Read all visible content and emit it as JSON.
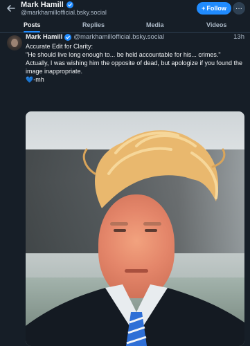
{
  "header": {
    "name": "Mark Hamill",
    "handle": "@markhamillofficial.bsky.social",
    "follow_label": "Follow",
    "more_label": "···"
  },
  "tabs": [
    {
      "label": "Posts",
      "active": true
    },
    {
      "label": "Replies",
      "active": false
    },
    {
      "label": "Media",
      "active": false
    },
    {
      "label": "Videos",
      "active": false
    }
  ],
  "post": {
    "author": "Mark Hamill",
    "handle": "@markhamillofficial.bsky.social",
    "time": "13h",
    "lines": [
      "Accurate Edit for Clarity:",
      "\"He should live long enough to...     be held accountable for his...      crimes.\"",
      "Actually, I was wishing him the opposite of dead, but apologize if you found the image inappropriate.",
      "💙-mh"
    ]
  },
  "colors": {
    "background": "#161e27",
    "accent": "#208bfe",
    "secondary_text": "#aebbc9"
  },
  "icons": [
    "back-arrow-icon",
    "verified-badge-icon",
    "plus-icon",
    "more-icon"
  ]
}
